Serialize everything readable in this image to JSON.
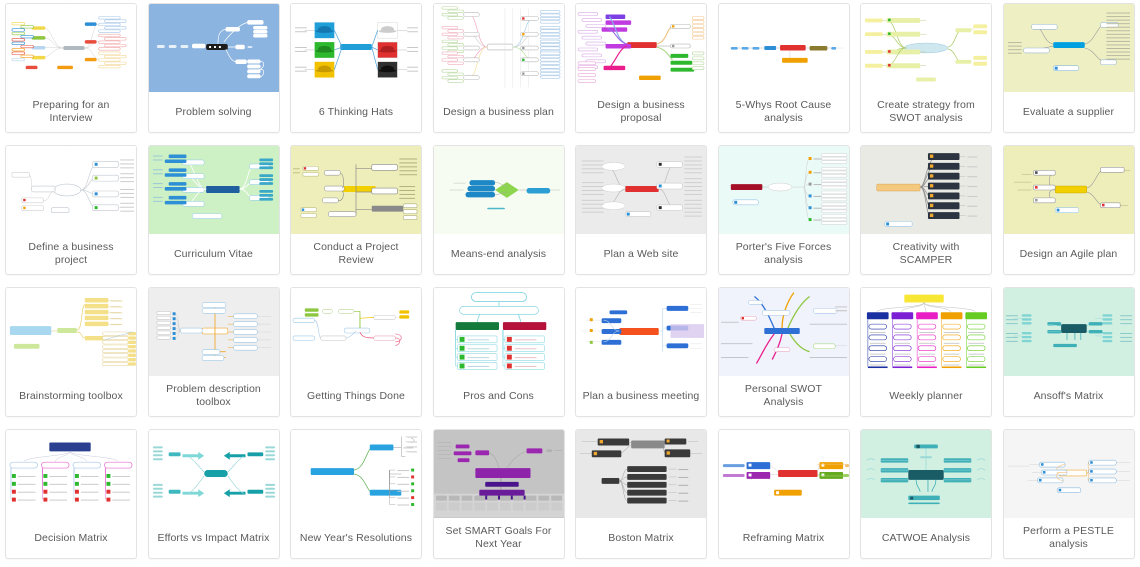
{
  "gallery": {
    "columns": 8,
    "rows": 4,
    "cards": [
      {
        "id": "preparing-for-an-interview",
        "label": "Preparing for an\nInterview",
        "thumb_bg": "#ffffff",
        "accent": "#4a90d9",
        "style": "radial-multicolor",
        "palette": [
          "#f0d849",
          "#8dc63f",
          "#2d8fd5",
          "#e74c3c",
          "#f39c12",
          "#b8d6ef"
        ]
      },
      {
        "id": "problem-solving",
        "label": "Problem solving",
        "thumb_bg": "#8cb4e0",
        "accent": "#2b2b2b",
        "style": "horizontal-dark-center",
        "palette": [
          "#1c1c1c",
          "#ffffff",
          "#d8e6f5"
        ]
      },
      {
        "id": "6-thinking-hats",
        "label": "6 Thinking Hats",
        "thumb_bg": "#ffffff",
        "accent": "#1f9ed8",
        "style": "six-hats",
        "palette": [
          "#1f9ed8",
          "#2eb82e",
          "#f2c200",
          "#ffffff",
          "#e03030",
          "#303030"
        ]
      },
      {
        "id": "design-a-business-plan",
        "label": "Design a business plan",
        "thumb_bg": "#ffffff",
        "accent": "#9aa5b1",
        "style": "dense-tree",
        "palette": [
          "#ef4a6b",
          "#f2c200",
          "#8dc63f",
          "#5aa9e6",
          "#bdbdbd"
        ]
      },
      {
        "id": "design-a-business-proposal",
        "label": "Design a business\nproposal",
        "thumb_bg": "#ffffff",
        "accent": "#e03030",
        "style": "radial-bars",
        "palette": [
          "#7b3fe4",
          "#c13ce0",
          "#e03030",
          "#f39c12",
          "#2eb82e",
          "#e91e8c"
        ]
      },
      {
        "id": "5-whys-root-cause-analysis",
        "label": "5-Whys Root Cause\nanalysis",
        "thumb_bg": "#ffffff",
        "accent": "#e03030",
        "style": "linear-chain",
        "palette": [
          "#5aa9e6",
          "#2d8fd5",
          "#e03030",
          "#8a7b2e",
          "#f0a000"
        ]
      },
      {
        "id": "create-strategy-from-swot-analysis",
        "label": "Create strategy from\nSWOT analysis",
        "thumb_bg": "#ffffff",
        "accent": "#9acd32",
        "style": "swot-lines",
        "palette": [
          "#f5ef9e",
          "#b8d96a",
          "#8dc63f",
          "#d6e89a"
        ]
      },
      {
        "id": "evaluate-a-supplier",
        "label": "Evaluate a supplier",
        "thumb_bg": "#eef0c4",
        "accent": "#00a0e0",
        "style": "radial-blue-center",
        "palette": [
          "#00a0e0",
          "#ffffff",
          "#d9dba0"
        ]
      },
      {
        "id": "define-a-business-project",
        "label": "Define a business project",
        "thumb_bg": "#ffffff",
        "accent": "#b8c4d0",
        "style": "outline-tree",
        "palette": [
          "#2d8fd5",
          "#8dc63f",
          "#e03030",
          "#f0a000",
          "#cccccc"
        ]
      },
      {
        "id": "curriculum-vitae",
        "label": "Curriculum Vitae",
        "thumb_bg": "#cdf0c4",
        "accent": "#1f5fa0",
        "style": "radial-blue-bar",
        "palette": [
          "#1f5fa0",
          "#2d8fd5",
          "#ffffff"
        ]
      },
      {
        "id": "conduct-a-project-review",
        "label": "Conduct a Project Review",
        "thumb_bg": "#eeeebb",
        "accent": "#f2d000",
        "style": "org-tree",
        "palette": [
          "#f2d000",
          "#9a9a9a",
          "#ffffff"
        ]
      },
      {
        "id": "means-end-analysis",
        "label": "Means-end analysis",
        "thumb_bg": "#f7fcf2",
        "accent": "#1e88c7",
        "style": "means-end",
        "palette": [
          "#1e88c7",
          "#8dd44f",
          "#2b9ed4"
        ]
      },
      {
        "id": "plan-a-web-site",
        "label": "Plan a Web site",
        "thumb_bg": "#ebebeb",
        "accent": "#e03030",
        "style": "radial-red-center",
        "palette": [
          "#e03030",
          "#ffffff",
          "#cccccc"
        ]
      },
      {
        "id": "porters-five-forces-analysis",
        "label": "Porter's Five Forces\nanalysis",
        "thumb_bg": "#eafaf7",
        "accent": "#a51028",
        "style": "forces-list",
        "palette": [
          "#a51028",
          "#f0a000",
          "#2d8fd5",
          "#2eb82e",
          "#ffffff"
        ]
      },
      {
        "id": "creativity-with-scamper",
        "label": "Creativity with SCAMPER",
        "thumb_bg": "#eaeae4",
        "accent": "#f0a830",
        "style": "scamper-ladder",
        "palette": [
          "#2b3440",
          "#f0a830",
          "#9a9a9a"
        ]
      },
      {
        "id": "design-an-agile-plan",
        "label": "Design an Agile plan",
        "thumb_bg": "#eeeebb",
        "accent": "#f2d000",
        "style": "agile-center",
        "palette": [
          "#f2d000",
          "#ffffff",
          "#d9d98f"
        ]
      },
      {
        "id": "brainstorming-toolbox",
        "label": "Brainstorming toolbox",
        "thumb_bg": "#ffffff",
        "accent": "#a8d8ef",
        "style": "brainstorm-fan",
        "palette": [
          "#a8d8ef",
          "#cde89a",
          "#f5e08a",
          "#f7f2c0"
        ]
      },
      {
        "id": "problem-description-toolbox",
        "label": "Problem description\ntoolbox",
        "thumb_bg": "#eeeeee",
        "accent": "#f0a830",
        "style": "problem-desc",
        "palette": [
          "#f0a830",
          "#a8d8ef",
          "#cccccc"
        ]
      },
      {
        "id": "getting-things-done",
        "label": "Getting Things Done",
        "thumb_bg": "#ffffff",
        "accent": "#8dc63f",
        "style": "gtd-flow",
        "palette": [
          "#8dc63f",
          "#f2c200",
          "#e8547a",
          "#5aa9e6",
          "#bbbbbb"
        ]
      },
      {
        "id": "pros-and-cons",
        "label": "Pros and Cons",
        "thumb_bg": "#ffffff",
        "accent": "#6fd0dd",
        "style": "pros-cons",
        "palette": [
          "#137a3c",
          "#b4123a",
          "#2eb82e",
          "#e03030",
          "#6fd0dd"
        ]
      },
      {
        "id": "plan-a-business-meeting",
        "label": "Plan a business meeting",
        "thumb_bg": "#ffffff",
        "accent": "#f4511e",
        "style": "meeting-center",
        "palette": [
          "#f4511e",
          "#2d6fd5",
          "#d8c8ee",
          "#cccccc"
        ]
      },
      {
        "id": "personal-swot-analysis",
        "label": "Personal SWOT Analysis",
        "thumb_bg": "#f0f3fc",
        "accent": "#2d6fd5",
        "style": "swot-radial",
        "palette": [
          "#2d6fd5",
          "#e91e8c",
          "#f0a000",
          "#8dc63f",
          "#4a4a4a"
        ]
      },
      {
        "id": "weekly-planner",
        "label": "Weekly planner",
        "thumb_bg": "#ffffff",
        "accent": "#f7e634",
        "style": "weekly-columns",
        "palette": [
          "#1a2fa0",
          "#7b1fd4",
          "#e91ec4",
          "#f0a000",
          "#66cc22",
          "#f7e634"
        ]
      },
      {
        "id": "ansoffs-matrix",
        "label": "Ansoff's Matrix",
        "thumb_bg": "#d2f0e2",
        "accent": "#1a5c66",
        "style": "ansoff-center",
        "palette": [
          "#1a5c66",
          "#3fb0b8",
          "#7fd4d4"
        ]
      },
      {
        "id": "decision-matrix",
        "label": "Decision Matrix",
        "thumb_bg": "#ffffff",
        "accent": "#2a3f8f",
        "style": "decision-matrix",
        "palette": [
          "#2a3f8f",
          "#e86bd0",
          "#a8c8e8",
          "#2eb82e",
          "#e03030"
        ]
      },
      {
        "id": "efforts-vs-impact-matrix",
        "label": "Efforts vs Impact Matrix",
        "thumb_bg": "#ffffff",
        "accent": "#18a0a8",
        "style": "efforts-impact",
        "palette": [
          "#18a0a8",
          "#7fd8d8",
          "#bdeaea"
        ]
      },
      {
        "id": "new-years-resolutions",
        "label": "New Year's Resolutions",
        "thumb_bg": "#ffffff",
        "accent": "#29a3e0",
        "style": "resolutions-tree",
        "palette": [
          "#29a3e0",
          "#8dc63f",
          "#2eb82e",
          "#e03030"
        ]
      },
      {
        "id": "set-smart-goals-for-next-year",
        "label": "Set SMART Goals For\nNext Year",
        "thumb_bg": "#c4c4c4",
        "accent": "#8e24aa",
        "style": "smart-goals",
        "palette": [
          "#8e24aa",
          "#6a1b9a",
          "#4a148c",
          "#d0d0d0"
        ]
      },
      {
        "id": "boston-matrix",
        "label": "Boston Matrix",
        "thumb_bg": "#e8e8e8",
        "accent": "#3a3a3a",
        "style": "boston-matrix",
        "palette": [
          "#3a3a3a",
          "#f0a830",
          "#8a8a8a"
        ]
      },
      {
        "id": "reframing-matrix",
        "label": "Reframing Matrix",
        "thumb_bg": "#ffffff",
        "accent": "#e03030",
        "style": "reframing",
        "palette": [
          "#2d6fd5",
          "#9b27b0",
          "#e03030",
          "#f0a000",
          "#66aa22"
        ]
      },
      {
        "id": "catwoe-analysis",
        "label": "CATWOE Analysis",
        "thumb_bg": "#d2f0e2",
        "accent": "#1a5c66",
        "style": "catwoe",
        "palette": [
          "#1a5c66",
          "#3fb0b8",
          "#7fd4d4"
        ]
      },
      {
        "id": "perform-a-pestle-analysis",
        "label": "Perform a PESTLE\nanalysis",
        "thumb_bg": "#f5f5f5",
        "accent": "#2d8fd5",
        "style": "pestle",
        "palette": [
          "#2d8fd5",
          "#f0a830",
          "#cfe2f3"
        ]
      }
    ]
  }
}
